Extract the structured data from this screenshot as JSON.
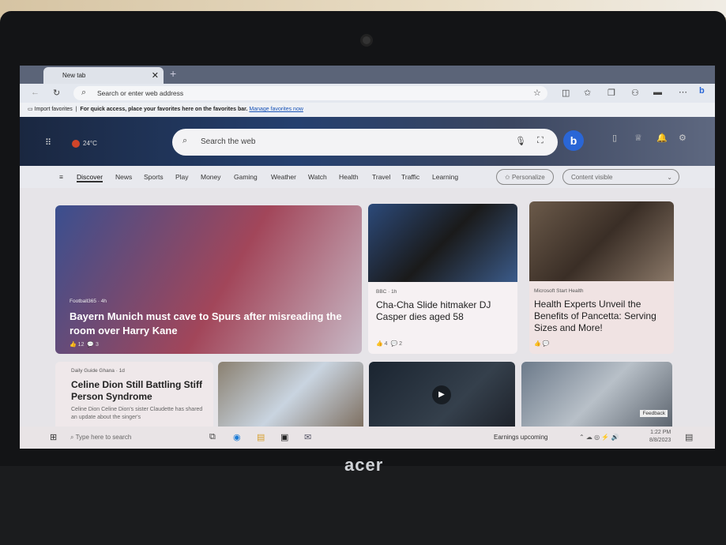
{
  "device": {
    "brand": "acer"
  },
  "browser": {
    "tab_title": "New tab",
    "address_placeholder": "Search or enter web address",
    "favorites_bar": {
      "import": "Import favorites",
      "message": "For quick access, place your favorites here on the favorites bar.",
      "link": "Manage favorites now"
    }
  },
  "header": {
    "weather": "24°C",
    "search_placeholder": "Search the web",
    "bing": "b"
  },
  "nav": {
    "items": [
      "Discover",
      "News",
      "Sports",
      "Play",
      "Money",
      "Gaming",
      "Weather",
      "Watch",
      "Health",
      "Travel",
      "Traffic",
      "Learning"
    ],
    "personalize": "Personalize",
    "content_visible": "Content visible"
  },
  "cards": [
    {
      "source": "Football365 · 4h",
      "title": "Bayern Munich must cave to Spurs after misreading the room over Harry Kane",
      "likes": "12",
      "comments": "3"
    },
    {
      "source": "BBC · 1h",
      "title": "Cha-Cha Slide hitmaker DJ Casper dies aged 58",
      "likes": "4",
      "comments": "2"
    },
    {
      "source": "Microsoft Start Health",
      "title": "Health Experts Unveil the Benefits of Pancetta: Serving Sizes and More!"
    },
    {
      "source": "Daily Guide Ghana · 1d",
      "title": "Celine Dion Still Battling Stiff Person Syndrome",
      "snippet": "Celine Dion Celine Dion's sister Claudette has shared an update about the singer's"
    }
  ],
  "feedback": "Feedback",
  "taskbar": {
    "search_placeholder": "Type here to search",
    "news": "Earnings upcoming",
    "time": "1:22 PM",
    "date": "8/8/2023"
  }
}
